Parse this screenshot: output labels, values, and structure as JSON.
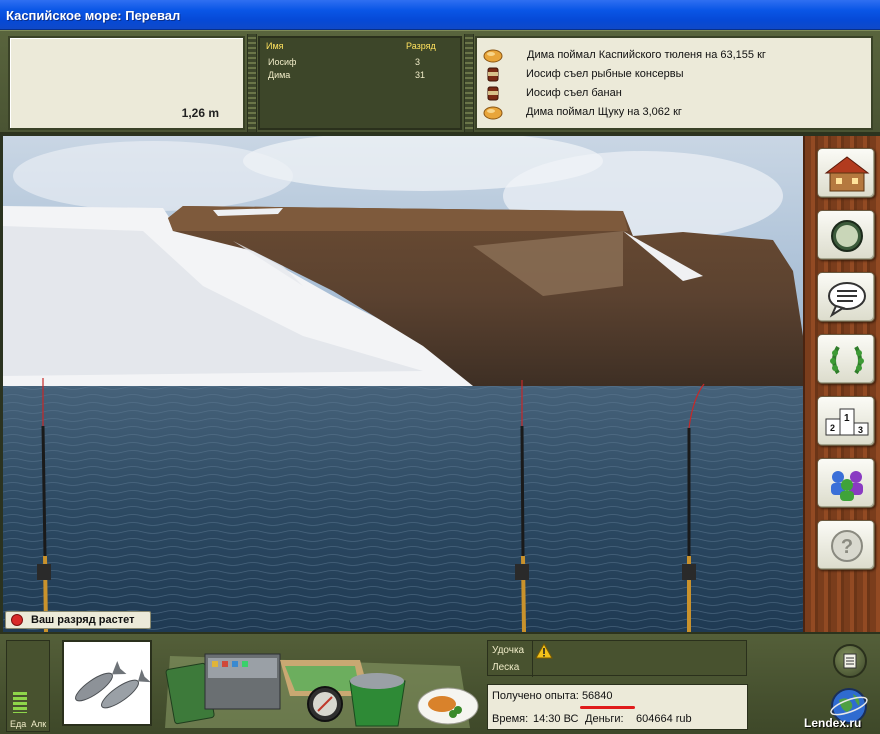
{
  "window": {
    "title": "Каспийское море: Перевал"
  },
  "depth": {
    "value": "1,26 m"
  },
  "players": {
    "header_name": "Имя",
    "header_rank": "Разряд",
    "rows": [
      {
        "name": "Иосиф",
        "rank": "3"
      },
      {
        "name": "Дима",
        "rank": "31"
      }
    ]
  },
  "event_log": [
    {
      "icon": "bread-icon",
      "text": "Дима поймал Каспийского тюленя на 63,155 кг"
    },
    {
      "icon": "can-icon",
      "text": "Иосиф съел рыбные консервы"
    },
    {
      "icon": "can-icon",
      "text": "Иосиф съел банан"
    },
    {
      "icon": "bread-icon",
      "text": "Дима поймал Щуку на 3,062 кг"
    }
  ],
  "notification": {
    "text": "Ваш разряд растет"
  },
  "side_buttons": [
    "house-icon",
    "compass-icon",
    "chat-icon",
    "laurel-icon",
    "podium-icon",
    "people-icon",
    "help-icon"
  ],
  "podium_numbers": [
    "1",
    "2",
    "3"
  ],
  "help_glyph": "?",
  "meters": {
    "food_label": "Еда",
    "alcohol_label": "Алк",
    "food_level": 0.3
  },
  "tackle": {
    "rod_label": "Удочка",
    "line_label": "Леска",
    "warning_icon": "warning-icon"
  },
  "stats": {
    "experience_label": "Получено опыта:",
    "experience_value": "56840",
    "time_label": "Время:",
    "time_value": "14:30 ВС",
    "money_label": "Деньги:",
    "money_value": "604664 rub"
  },
  "watermark": "Lendex.ru",
  "colors": {
    "title_bar": "#0a56e6",
    "panel": "#4a5433",
    "accent_underline": "#e01b1b",
    "player_header": "#ffe25e"
  }
}
